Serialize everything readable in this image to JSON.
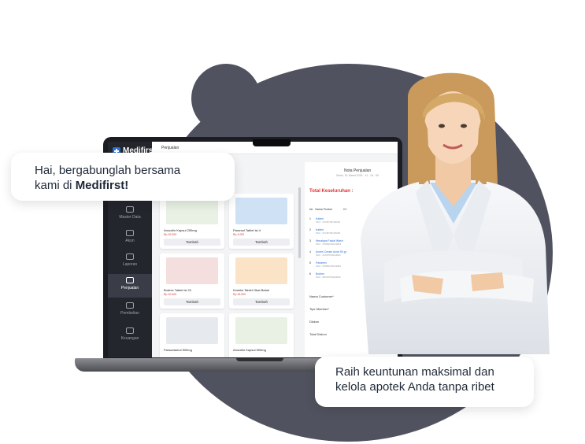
{
  "app": {
    "logo_text": "Medifirst",
    "page_title": "Penjualan"
  },
  "sidebar": {
    "items": [
      {
        "label": "Master Data",
        "icon": "database-icon"
      },
      {
        "label": "Akun",
        "icon": "user-icon"
      },
      {
        "label": "Laporan",
        "icon": "chart-icon"
      },
      {
        "label": "Penjualan",
        "icon": "inbox-icon",
        "active": true
      },
      {
        "label": "Pembelian",
        "icon": "cart-icon"
      },
      {
        "label": "Keuangan",
        "icon": "wallet-icon"
      }
    ]
  },
  "products": [
    {
      "name": "Amoxilin Kapsul 250mg",
      "price": "Rp 20.000",
      "button": "Tambah",
      "color": "#e8f1e4"
    },
    {
      "name": "Paramol Tablet isi 4",
      "price": "Rp 4.000",
      "button": "Tambah",
      "color": "#cfe2f5"
    },
    {
      "name": "Bodrex Tablet isi 20",
      "price": "Rp 10.000",
      "button": "Tambah",
      "color": "#f4dede"
    },
    {
      "name": "Komiks Tablet Obat Batuk",
      "price": "Rp 25.000",
      "button": "Tambah",
      "color": "#fbe3c8"
    },
    {
      "name": "Paracetamol 500mg",
      "price": "",
      "button": "",
      "color": "#e6e9ee"
    },
    {
      "name": "Amoxilin Kapsul 500mg",
      "price": "",
      "button": "",
      "color": "#e8f1e4"
    }
  ],
  "receipt": {
    "title": "Nota Penjualan",
    "date": "Senin, 01 Maret 2024 · 11 : 24 : 09",
    "total_label": "Total Keseluruhan :",
    "col_no": "No",
    "col_product": "Nama Produk",
    "col_qty": "Kt",
    "rows": [
      {
        "no": "1",
        "name": "Kalteri",
        "sku": "SKU : PLN9730123001"
      },
      {
        "no": "2",
        "name": "Kalteri",
        "sku": "SKU : PLN9730123002"
      },
      {
        "no": "3",
        "name": "Himalaya Facial Wash",
        "sku": "SKU : PHM9730123003"
      },
      {
        "no": "4",
        "name": "Acnes Cream Acne 50 gr",
        "sku": "SKU : ACN9730123004"
      },
      {
        "no": "5",
        "name": "Paramex",
        "sku": "SKU : PRM9730123005"
      },
      {
        "no": "6",
        "name": "Bodrex",
        "sku": "SKU : BDX9730123006"
      }
    ],
    "fields": [
      "Nama Customer*",
      "Tipe Member*",
      "Diskon",
      "Total Diskon"
    ]
  },
  "bubbles": {
    "first_line": "Hai, bergabunglah bersama",
    "second_prefix": "kami di ",
    "second_bold": "Medifirst!",
    "promo_line1": "Raih keuntunan maksimal dan",
    "promo_line2": "kelola apotek Anda tanpa ribet"
  },
  "colors": {
    "background_blob": "#50535f",
    "sidebar": "#24262d",
    "accent_red": "#e03131",
    "accent_blue": "#2b6fd6"
  }
}
